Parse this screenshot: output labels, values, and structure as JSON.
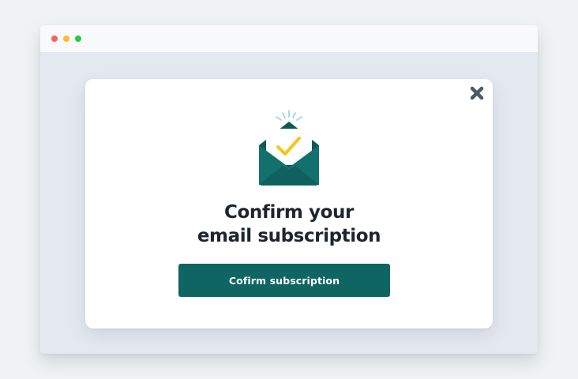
{
  "window": {
    "controls": [
      {
        "name": "close",
        "color": "#fe5f57"
      },
      {
        "name": "minimize",
        "color": "#febc2e"
      },
      {
        "name": "maximize",
        "color": "#28c840"
      }
    ]
  },
  "modal": {
    "close_icon": "close-icon",
    "envelope_icon": "envelope-check-icon",
    "title_line1": "Confirm your",
    "title_line2": "email subscription",
    "button_label": "Cofirm subscription"
  },
  "colors": {
    "accent": "#0e6561",
    "check": "#f5c518",
    "close_icon": "#4d5a66",
    "title": "#1d2530"
  }
}
